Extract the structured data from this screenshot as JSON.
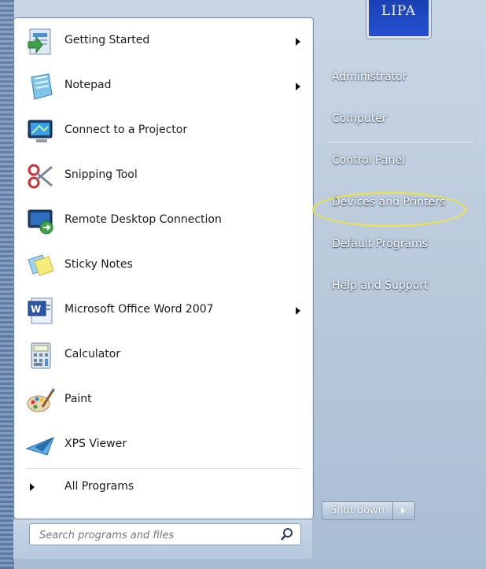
{
  "user": {
    "picture_text": "LIPA"
  },
  "programs": [
    {
      "label": "Getting Started",
      "has_submenu": true,
      "icon": "getting-started-icon"
    },
    {
      "label": "Notepad",
      "has_submenu": true,
      "icon": "notepad-icon"
    },
    {
      "label": "Connect to a Projector",
      "has_submenu": false,
      "icon": "projector-icon"
    },
    {
      "label": "Snipping Tool",
      "has_submenu": false,
      "icon": "scissors-icon"
    },
    {
      "label": "Remote Desktop Connection",
      "has_submenu": false,
      "icon": "remote-desktop-icon"
    },
    {
      "label": "Sticky Notes",
      "has_submenu": false,
      "icon": "sticky-notes-icon"
    },
    {
      "label": "Microsoft Office Word 2007",
      "has_submenu": true,
      "icon": "word-icon"
    },
    {
      "label": "Calculator",
      "has_submenu": false,
      "icon": "calculator-icon"
    },
    {
      "label": "Paint",
      "has_submenu": false,
      "icon": "paint-icon"
    },
    {
      "label": "XPS Viewer",
      "has_submenu": false,
      "icon": "xps-viewer-icon"
    }
  ],
  "all_programs": {
    "label": "All Programs"
  },
  "search": {
    "placeholder": "Search programs and files",
    "value": ""
  },
  "right_pane": {
    "items": [
      {
        "label": "Administrator"
      },
      {
        "label": "Computer"
      },
      {
        "label": "Control Panel"
      },
      {
        "label": "Devices and Printers"
      },
      {
        "label": "Default Programs"
      },
      {
        "label": "Help and Support"
      }
    ],
    "highlighted_item": "Devices and Printers",
    "highlight_color": "#f0e43a"
  },
  "shutdown": {
    "label": "Shut down"
  }
}
